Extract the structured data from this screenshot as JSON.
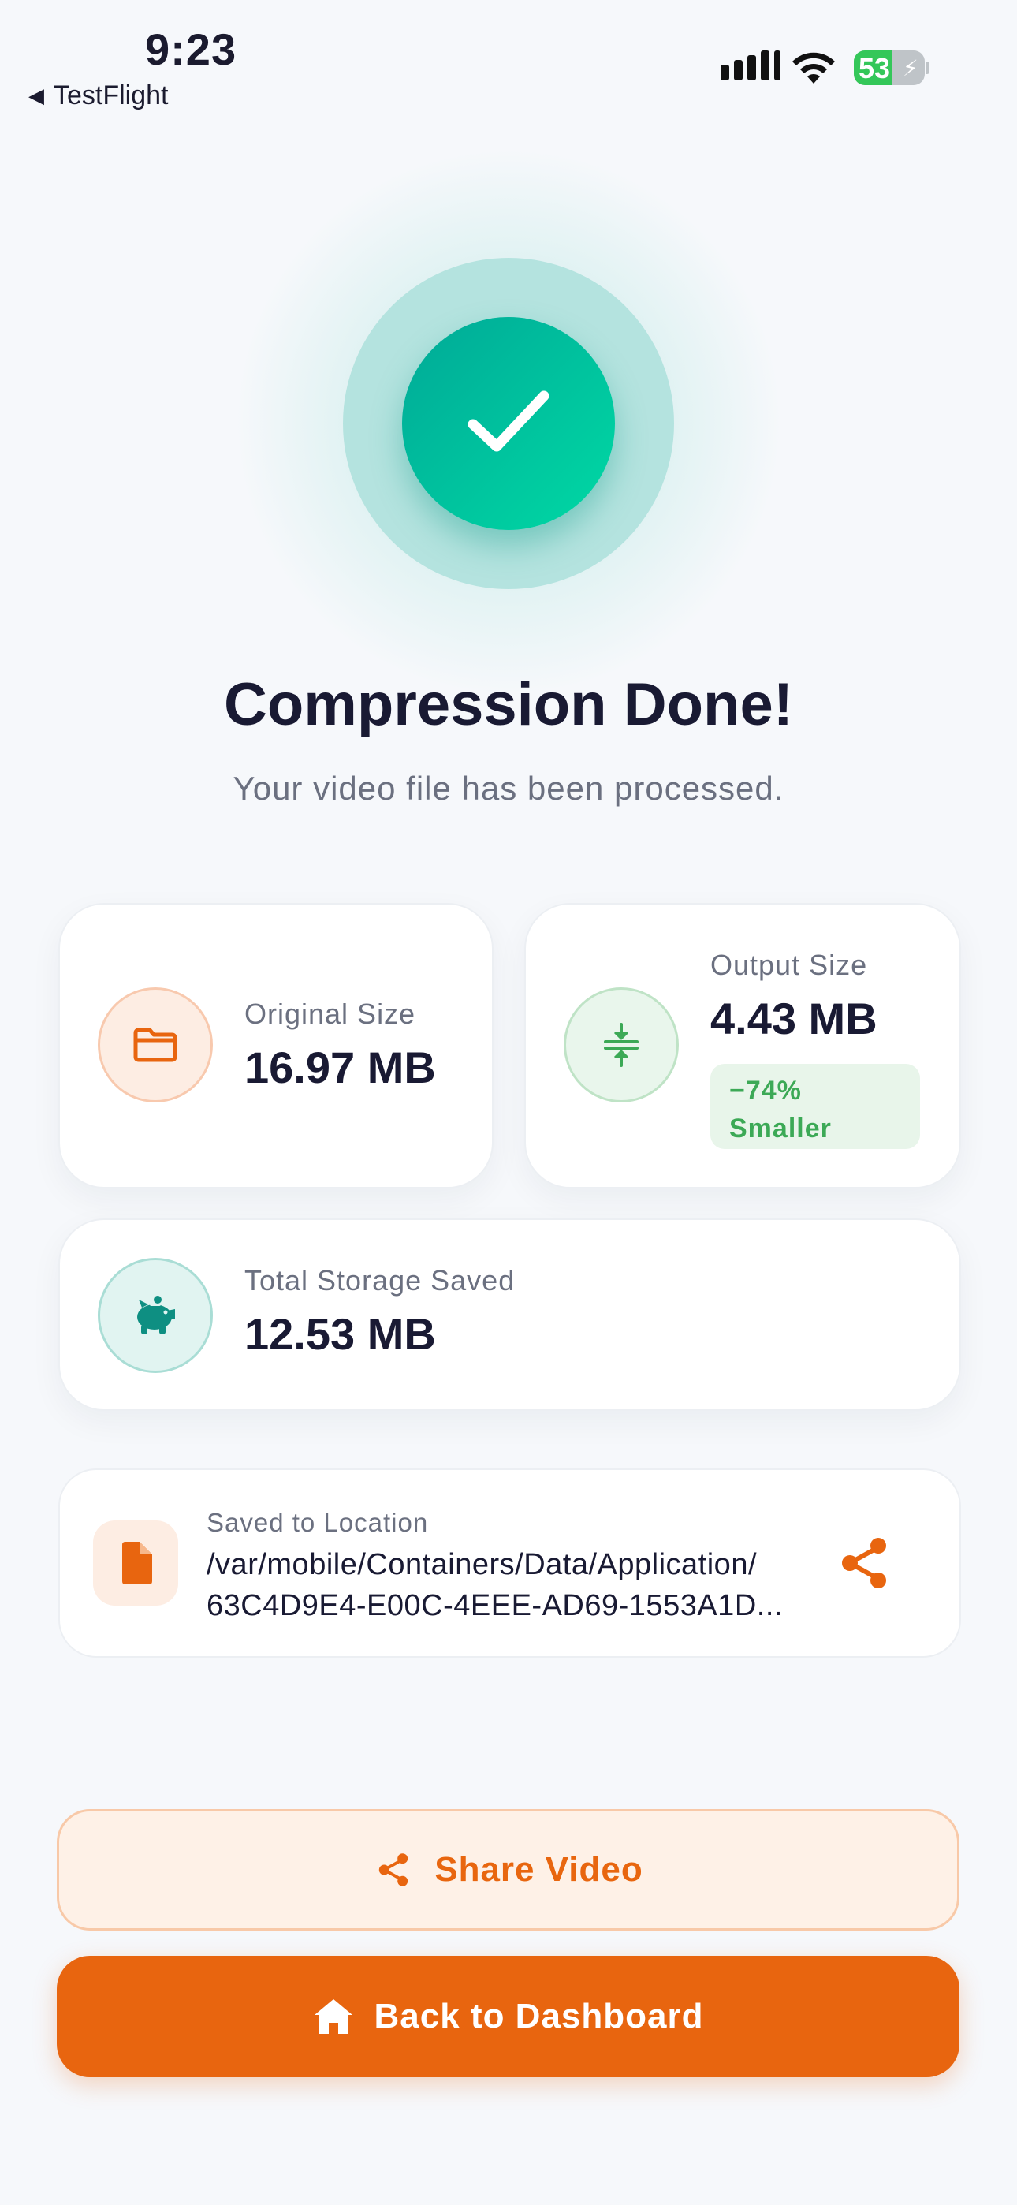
{
  "status_bar": {
    "time": "9:23",
    "back_app": "TestFlight",
    "battery_percent": "53"
  },
  "hero": {
    "title": "Compression Done!",
    "subtitle": "Your video file has been processed."
  },
  "stats": {
    "original": {
      "label": "Original Size",
      "value": "16.97 MB",
      "icon": "folder-icon"
    },
    "output": {
      "label": "Output Size",
      "value": "4.43 MB",
      "badge_line1": "−74%",
      "badge_line2": "Smaller",
      "icon": "compress-icon"
    },
    "saved": {
      "label": "Total Storage Saved",
      "value": "12.53 MB",
      "icon": "piggy-bank-icon"
    }
  },
  "location": {
    "label": "Saved to Location",
    "path_line1": "/var/mobile/Containers/Data/Application/",
    "path_line2": "63C4D9E4-E00C-4EEE-AD69-1553A1D..."
  },
  "actions": {
    "share_label": "Share Video",
    "home_label": "Back to Dashboard"
  },
  "colors": {
    "accent": "#E8650F",
    "success": "#00C09C",
    "background": "#F6F8FB"
  }
}
